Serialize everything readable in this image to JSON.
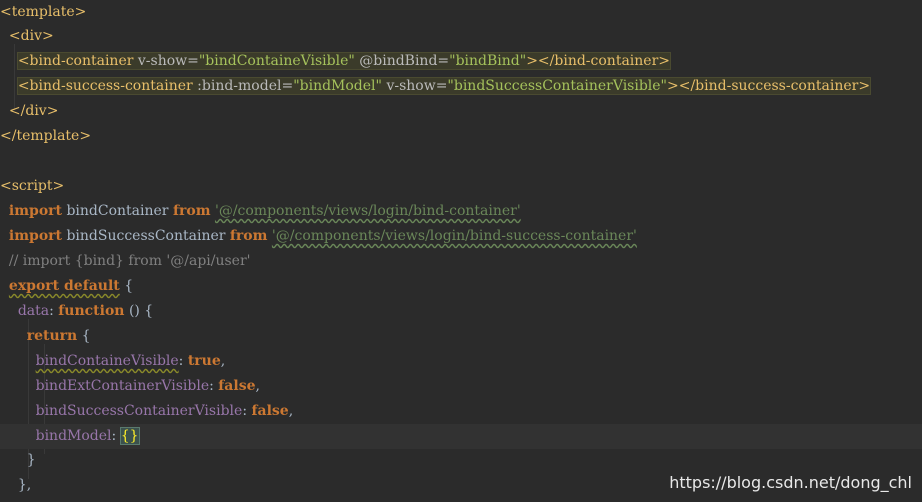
{
  "code": {
    "l1": {
      "lt": "<",
      "tag": "template",
      "gt": ">"
    },
    "l2": {
      "lt": "<",
      "tag": "div",
      "gt": ">"
    },
    "l3": {
      "open": "<bind-container",
      "a1": "v-show=",
      "v1": "\"bindContaineVisible\"",
      "a2": "@bindBind=",
      "v2": "\"bindBind\"",
      "close": "></bind-container>"
    },
    "l4": {
      "open": "<bind-success-container",
      "a1": ":bind-model=",
      "v1": "\"bindModel\"",
      "a2": "v-show=",
      "v2": "\"bindSuccessContainerVisible\"",
      "close": "></bind-success-container>"
    },
    "l5": {
      "text": "</div>"
    },
    "l6": {
      "text": "</template>"
    },
    "l7": {
      "text": "<script>"
    },
    "l8": {
      "kw": "import",
      "id": "bindContainer",
      "from": "from",
      "str": "'@/components/views/login/bind-container'"
    },
    "l9": {
      "kw": "import",
      "id": "bindSuccessContainer",
      "from": "from",
      "str": "'@/components/views/login/bind-success-container'"
    },
    "l10": {
      "text": "// import {bind} from '@/api/user'"
    },
    "l11": {
      "kw": "export default",
      "rest": "{"
    },
    "l12": {
      "prop": "data",
      "colon": ":",
      "kw": "function",
      "rest": "() {"
    },
    "l13": {
      "kw": "return",
      "rest": "{"
    },
    "l14": {
      "prop": "bindContaineVisible",
      "colon": ":",
      "val": "true",
      "comma": ","
    },
    "l15": {
      "prop": "bindExtContainerVisible",
      "colon": ":",
      "val": "false",
      "comma": ","
    },
    "l16": {
      "prop": "bindSuccessContainerVisible",
      "colon": ":",
      "val": "false",
      "comma": ","
    },
    "l17": {
      "prop": "bindModel",
      "colon": ":",
      "val": "{}"
    },
    "l18": {
      "text": "}"
    },
    "l19": {
      "text": "},"
    }
  },
  "watermark": "https://blog.csdn.net/dong_chl"
}
